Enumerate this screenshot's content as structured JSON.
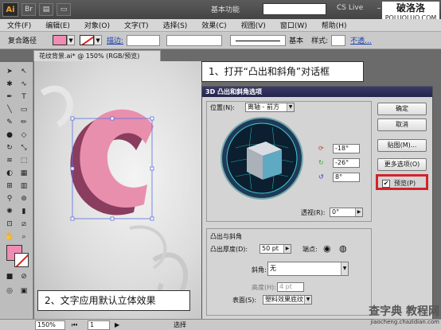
{
  "app": {
    "logo": "Ai",
    "workspace": "基本功能",
    "cs_live": "CS Live",
    "watermark_top": {
      "title": "破洛洛",
      "url": "POLUOLUO.COM"
    },
    "watermark_bottom": {
      "title": "查字典 教程网",
      "url": "jiaocheng.chazidian.com"
    }
  },
  "menubar": {
    "items": [
      "文件(F)",
      "编辑(E)",
      "对象(O)",
      "文字(T)",
      "选择(S)",
      "效果(C)",
      "视图(V)",
      "窗口(W)",
      "帮助(H)"
    ]
  },
  "control_bar": {
    "object_type": "复合路径",
    "fill_color": "#f08cb4",
    "stroke_label": "描边:",
    "stroke_style": "基本",
    "style_label": "样式:",
    "opacity_label": "不透..."
  },
  "document": {
    "tab": "花纹背景.ai* @ 150% (RGB/预览)"
  },
  "callouts": {
    "step1": "1、打开“凸出和斜角”对话框",
    "step2": "2、文字应用默认立体效果"
  },
  "dialog": {
    "title": "3D 凸出和斜角选项",
    "position_label": "位置(N):",
    "position_value": "离轴 - 前方",
    "rotate_x": "-18°",
    "rotate_y": "-26°",
    "rotate_z": "8°",
    "perspective_label": "透视(R):",
    "perspective_value": "0°",
    "extrude_section": "凸出与斜角",
    "extrude_depth_label": "凸出厚度(D):",
    "extrude_depth_value": "50 pt",
    "cap_label": "端点:",
    "bevel_label": "斜角:",
    "bevel_value": "无",
    "height_label": "高度(H):",
    "height_value": "4 pt",
    "surface_label": "表面(S):",
    "surface_value": "塑料效果底纹",
    "buttons": {
      "ok": "确定",
      "cancel": "取消",
      "map": "贴图(M)...",
      "more": "更多选项(O)"
    },
    "preview_label": "预览(P)",
    "preview_checked": true
  },
  "status_bar": {
    "zoom": "150%",
    "page": "1",
    "tool": "选择"
  }
}
